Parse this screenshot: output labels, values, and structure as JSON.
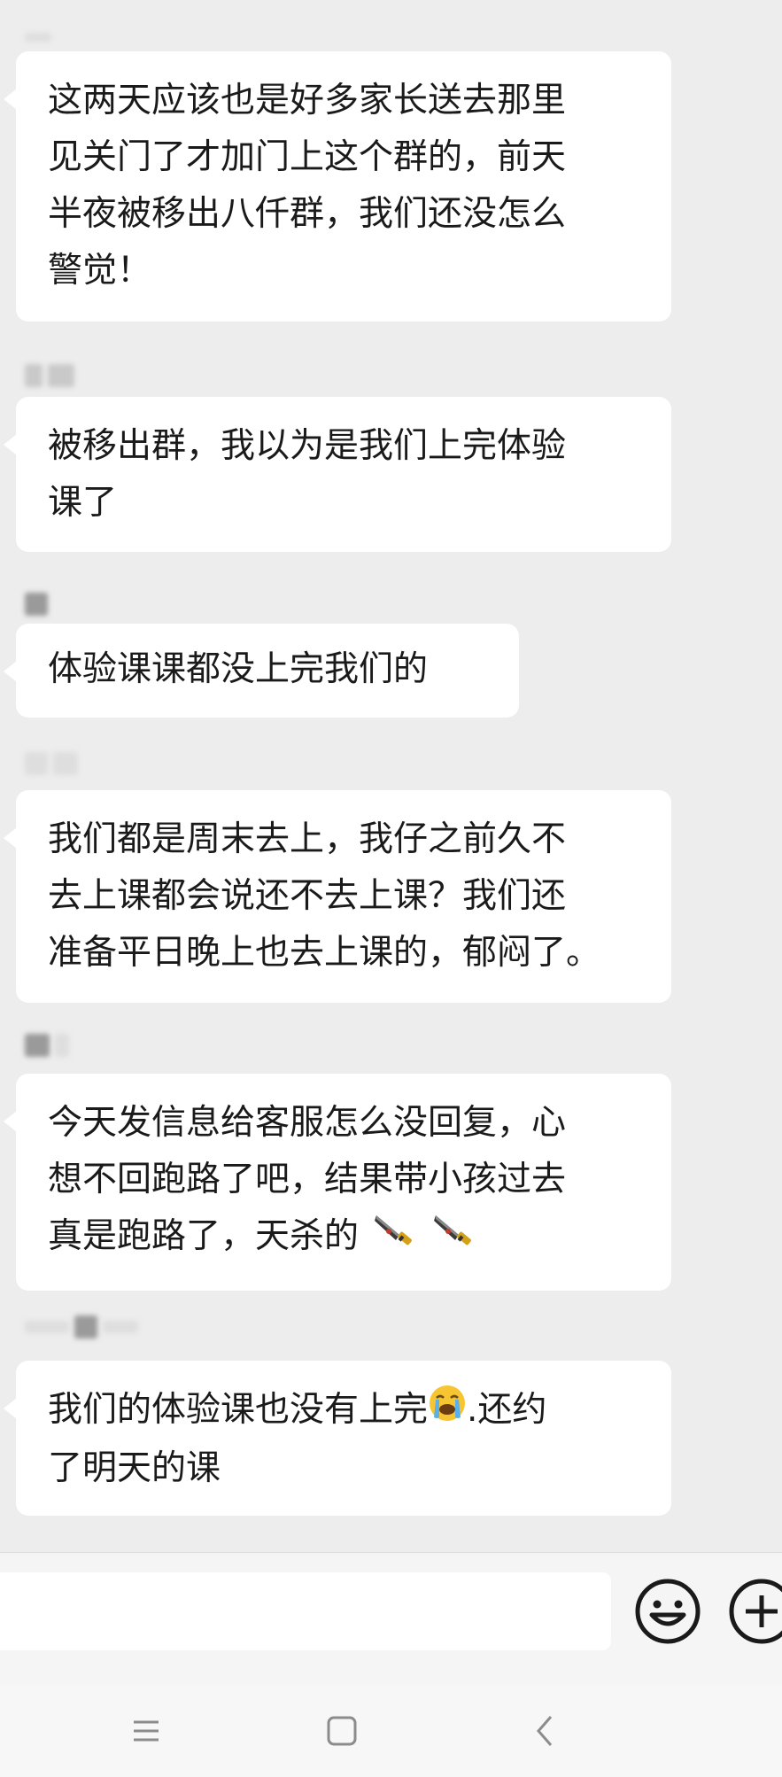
{
  "chat": {
    "messages": [
      {
        "lines": [
          "这两天应该也是好多家长送去那里",
          "见关门了才加门上这个群的，前天",
          "半夜被移出八仟群，我们还没怎么",
          "警觉！"
        ]
      },
      {
        "lines": [
          "被移出群，我以为是我们上完体验",
          "课了"
        ]
      },
      {
        "lines": [
          "体验课课都没上完我们的"
        ]
      },
      {
        "lines": [
          "我们都是周末去上，我仔之前久不",
          "去上课都会说还不去上课？我们还",
          "准备平日晚上也去上课的，郁闷了。"
        ]
      },
      {
        "lines": [
          "今天发信息给客服怎么没回复，心",
          "想不回跑路了吧，结果带小孩过去",
          "真是跑路了，天杀的"
        ],
        "emoji": [
          "kitchen-knife-icon",
          "kitchen-knife-icon"
        ]
      },
      {
        "lines_a": "我们的体验课也没有上完",
        "lines_a_tail": ".还约",
        "lines_b": "了明天的课",
        "emoji": [
          "loudly-crying-face-icon"
        ]
      }
    ]
  },
  "input_bar": {
    "placeholder": "",
    "icons": [
      "smiley-face-icon",
      "add-plus-icon"
    ]
  },
  "nav_bar": {
    "icons": [
      "menu-icon",
      "home-square-icon",
      "back-chevron-icon"
    ]
  },
  "colors": {
    "background": "#ededed",
    "bubble": "#ffffff",
    "text": "#1a1a1a"
  }
}
